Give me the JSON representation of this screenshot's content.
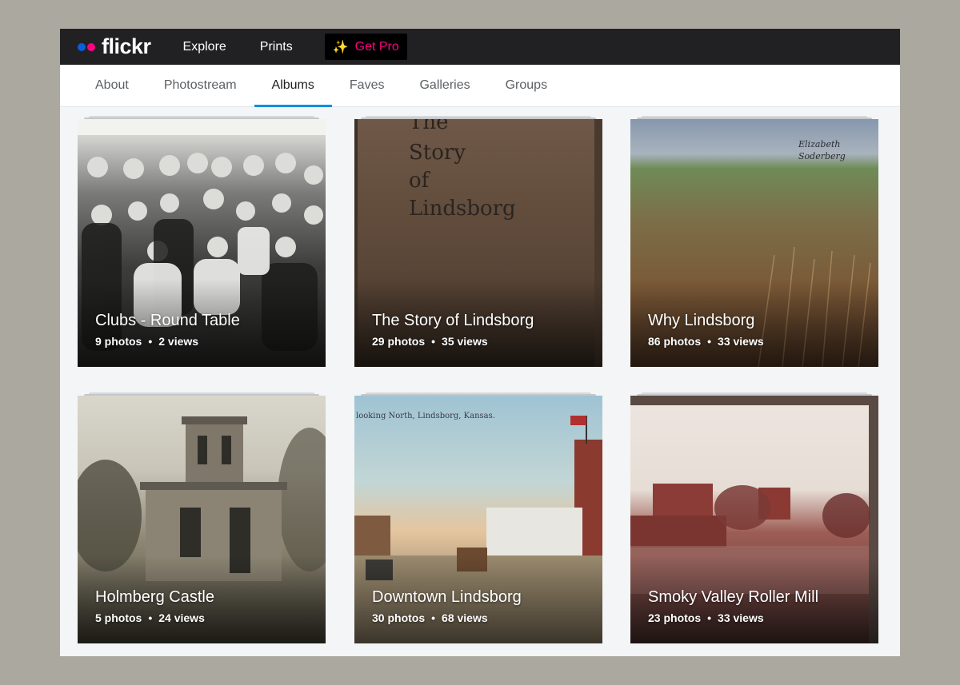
{
  "topbar": {
    "logo_text": "flickr",
    "nav": [
      {
        "label": "Explore"
      },
      {
        "label": "Prints"
      }
    ],
    "get_pro_label": "Get Pro"
  },
  "subnav": {
    "tabs": [
      {
        "label": "About"
      },
      {
        "label": "Photostream"
      },
      {
        "label": "Albums"
      },
      {
        "label": "Faves"
      },
      {
        "label": "Galleries"
      },
      {
        "label": "Groups"
      }
    ],
    "active_tab": "Albums"
  },
  "albums": [
    {
      "title": "Clubs - Round Table",
      "photos": "9 photos",
      "views": "2 views"
    },
    {
      "title": "The Story of Lindsborg",
      "photos": "29 photos",
      "views": "35 views",
      "cover_text": [
        "The",
        "Story",
        "of",
        "Lindsborg"
      ]
    },
    {
      "title": "Why Lindsborg",
      "photos": "86 photos",
      "views": "33 views",
      "cover_text": [
        "Elizabeth",
        "Soderberg"
      ]
    },
    {
      "title": "Holmberg Castle",
      "photos": "5 photos",
      "views": "24 views"
    },
    {
      "title": "Downtown Lindsborg",
      "photos": "30 photos",
      "views": "68 views",
      "cover_text": "looking North, Lindsborg, Kansas."
    },
    {
      "title": "Smoky Valley Roller Mill",
      "photos": "23 photos",
      "views": "33 views"
    }
  ],
  "meta_separator": "•",
  "colors": {
    "brand_blue": "#0a5edb",
    "brand_pink": "#ff0084",
    "tab_underline": "#128fdc",
    "topbar_bg": "#212124"
  }
}
